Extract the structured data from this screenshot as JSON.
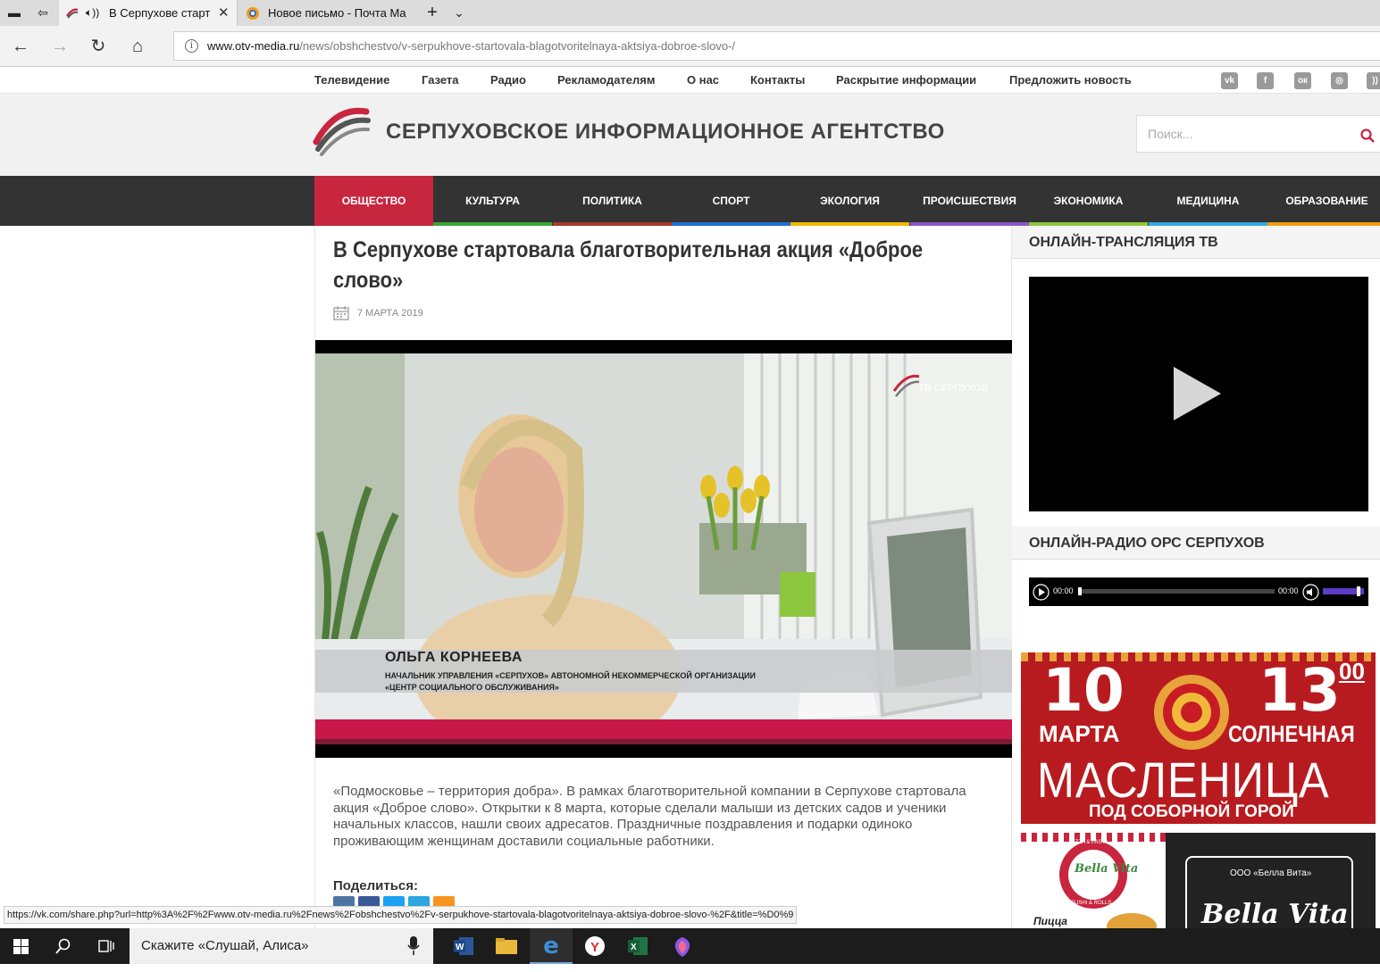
{
  "browser": {
    "tabs": [
      {
        "label": "В Серпухове старт",
        "active": true
      },
      {
        "label": "Новое письмо - Почта Ма",
        "active": false
      }
    ],
    "address": {
      "host": "www.otv-media.ru",
      "path": "/news/obshchestvo/v-serpukhove-startovala-blagotvoritelnaya-aktsiya-dobroe-slovo-/"
    }
  },
  "site": {
    "top_menu": [
      "Телевидение",
      "Газета",
      "Радио",
      "Рекламодателям",
      "О нас",
      "Контакты",
      "Раскрытие информации",
      "Предложить новость"
    ],
    "social": [
      {
        "icon": "vk-icon",
        "glyph": "vk"
      },
      {
        "icon": "facebook-icon",
        "glyph": "f"
      },
      {
        "icon": "odnoklassniki-icon",
        "glyph": "ок"
      },
      {
        "icon": "instagram-icon",
        "glyph": "◎"
      },
      {
        "icon": "rss-icon",
        "glyph": "))"
      }
    ],
    "logo_title": "СЕРПУХОВСКОЕ ИНФОРМАЦИОННОЕ АГЕНТСТВО",
    "search_placeholder": "Поиск...",
    "categories": [
      {
        "label": "ОБЩЕСТВО",
        "color": "#c8253e",
        "active": true
      },
      {
        "label": "КУЛЬТУРА",
        "color": "#3aa63a"
      },
      {
        "label": "ПОЛИТИКА",
        "color": "#a83a2a"
      },
      {
        "label": "СПОРТ",
        "color": "#1f6fd1"
      },
      {
        "label": "ЭКОЛОГИЯ",
        "color": "#f2b705"
      },
      {
        "label": "ПРОИСШЕСТВИЯ",
        "color": "#8a57c8"
      },
      {
        "label": "ЭКОНОМИКА",
        "color": "#8ec63f"
      },
      {
        "label": "МЕДИЦИНА",
        "color": "#35a8e0"
      },
      {
        "label": "ОБРАЗОВАНИЕ",
        "color": "#f39c12"
      }
    ]
  },
  "article": {
    "title": "В Серпухове стартовала благотворительная акция «Доброе слово»",
    "date": "7 МАРТА 2019",
    "video": {
      "watermark": "ТВ СЕРПУХОВ",
      "caption_name": "ОЛЬГА КОРНЕЕВА",
      "caption_line1": "НАЧАЛЬНИК УПРАВЛЕНИЯ «СЕРПУХОВ» АВТОНОМНОЙ НЕКОММЕРЧЕСКОЙ ОРГАНИЗАЦИИ",
      "caption_line2": "«ЦЕНТР СОЦИАЛЬНОГО ОБСЛУЖИВАНИЯ»"
    },
    "lead": "«Подмосковье – территория добра». В рамках благотворительной компании в Серпухове стартовала акция «Доброе слово». Открытки к 8 марта, которые сделали малыши из детских садов и ученики начальных классов, нашли своих адресатов. Праздничные поздравления и подарки  одиноко проживающим женщинам доставили социальные работники.",
    "share_label": "Поделиться:"
  },
  "sidebar": {
    "tv_heading": "ОНЛАЙН-ТРАНСЛЯЦИЯ ТВ",
    "radio_heading": "ОНЛАЙН-РАДИО ОРС СЕРПУХОВ",
    "radio_time_left": "00:00",
    "radio_time_right": "00:00",
    "ad1": {
      "day": "10",
      "month": "МАРТА",
      "time": "13",
      "time_minutes": "00",
      "title_small": "СОЛНЕЧНАЯ",
      "title": "МАСЛЕНИЦА",
      "subtitle": "ПОД СОБОРНОЙ ГОРОЙ"
    },
    "ad2": {
      "brand": "Bella Vita",
      "company": "ООО «Белла Вита»",
      "pizza": "Пицца",
      "logo_top": "PIZZA & PASTA",
      "logo_bottom": "SUSHI & ROLLS"
    }
  },
  "statusbar": "https://vk.com/share.php?url=http%3A%2F%2Fwww.otv-media.ru%2Fnews%2Fobshchestvo%2Fv-serpukhove-startovala-blagotvoritelnaya-aktsiya-dobroe-slovo-%2F&title=%D0%9",
  "taskbar": {
    "cortana_placeholder": "Скажите «Слушай, Алиса»"
  }
}
